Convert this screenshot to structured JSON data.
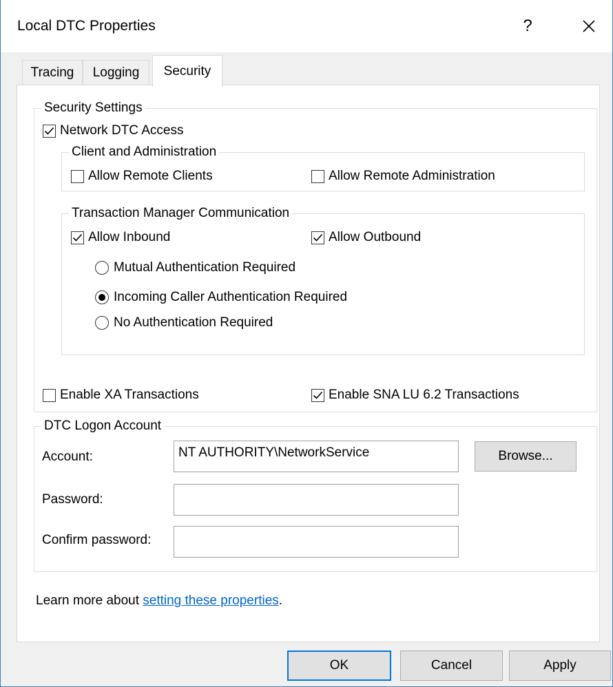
{
  "window": {
    "title": "Local DTC Properties",
    "help_label": "?",
    "close_icon": "close-icon"
  },
  "tabs": [
    {
      "label": "Tracing",
      "active": false
    },
    {
      "label": "Logging",
      "active": false
    },
    {
      "label": "Security",
      "active": true
    }
  ],
  "security_settings": {
    "legend": "Security Settings",
    "network_dtc_access": {
      "label": "Network DTC Access",
      "checked": true
    },
    "client_admin": {
      "legend": "Client and Administration",
      "allow_remote_clients": {
        "label": "Allow Remote Clients",
        "checked": false
      },
      "allow_remote_admin": {
        "label": "Allow Remote Administration",
        "checked": false
      }
    },
    "tm_comm": {
      "legend": "Transaction Manager Communication",
      "allow_inbound": {
        "label": "Allow Inbound",
        "checked": true
      },
      "allow_outbound": {
        "label": "Allow Outbound",
        "checked": true
      },
      "auth_options": [
        {
          "label": "Mutual Authentication Required",
          "selected": false
        },
        {
          "label": "Incoming Caller Authentication Required",
          "selected": true
        },
        {
          "label": "No Authentication Required",
          "selected": false
        }
      ]
    },
    "enable_xa": {
      "label": "Enable XA Transactions",
      "checked": false
    },
    "enable_sna": {
      "label": "Enable SNA LU 6.2 Transactions",
      "checked": true
    }
  },
  "logon_account": {
    "legend": "DTC Logon Account",
    "account_label": "Account:",
    "account_value": "NT AUTHORITY\\NetworkService",
    "browse_label": "Browse...",
    "password_label": "Password:",
    "password_value": "",
    "confirm_label": "Confirm password:",
    "confirm_value": ""
  },
  "learn_more": {
    "prefix": "Learn more about ",
    "link_text": "setting these properties",
    "suffix": "."
  },
  "buttons": {
    "ok": "OK",
    "cancel": "Cancel",
    "apply": "Apply"
  },
  "colors": {
    "accent": "#0078d7",
    "link": "#0066cc",
    "window_border": "#3c7fb1"
  }
}
